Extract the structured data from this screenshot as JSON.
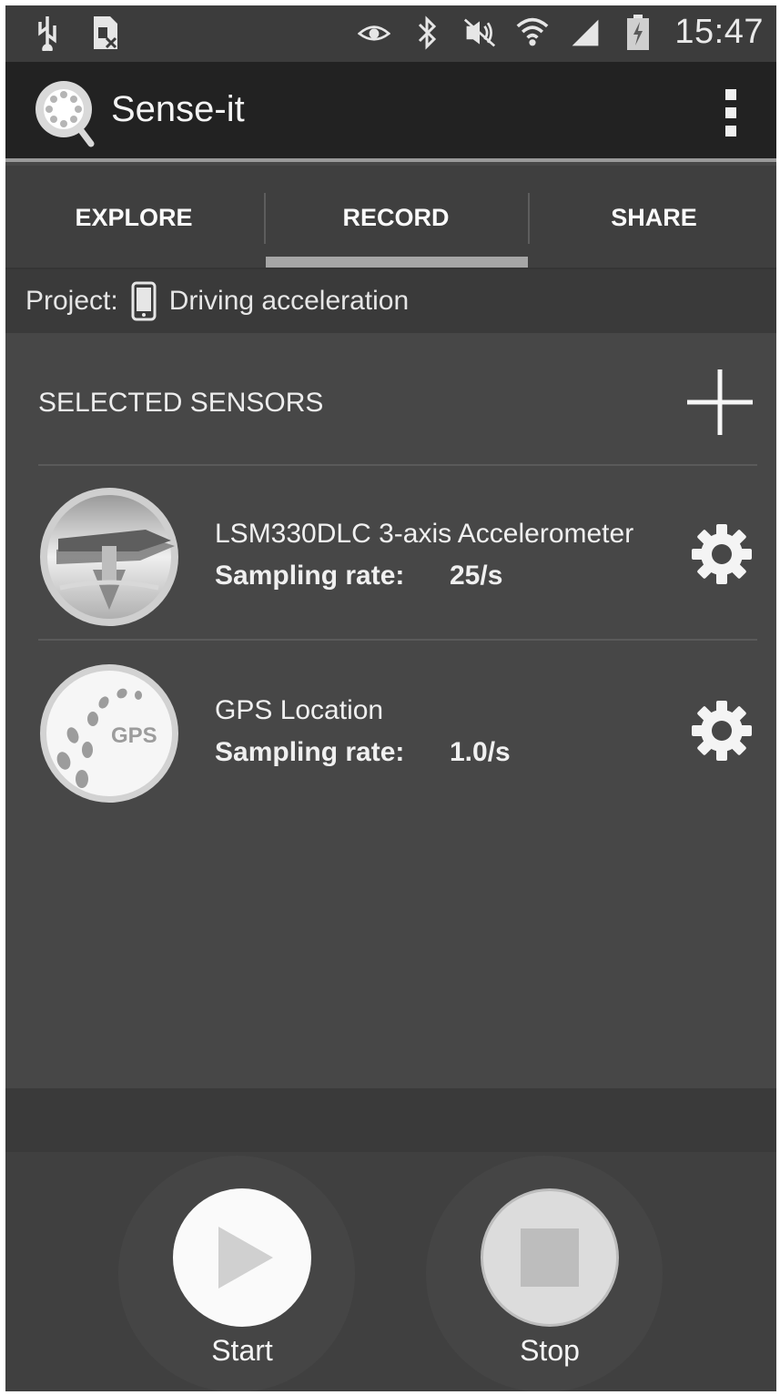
{
  "status_bar": {
    "time": "15:47",
    "icons_left": [
      "usb-icon",
      "no-sim-icon"
    ],
    "icons_right": [
      "eye-icon",
      "bluetooth-icon",
      "muted-icon",
      "wifi-icon",
      "signal-icon",
      "battery-icon"
    ]
  },
  "app": {
    "title": "Sense-it"
  },
  "tabs": [
    {
      "label": "EXPLORE",
      "selected": false
    },
    {
      "label": "RECORD",
      "selected": true
    },
    {
      "label": "SHARE",
      "selected": false
    }
  ],
  "project": {
    "prefix": "Project:",
    "name": "Driving acceleration"
  },
  "sensors_section": {
    "title": "SELECTED SENSORS",
    "items": [
      {
        "name": "LSM330DLC 3-axis Accelerometer",
        "rate_label": "Sampling rate:",
        "rate_value": "25/s",
        "icon": "accelerometer-icon"
      },
      {
        "name": "GPS Location",
        "rate_label": "Sampling rate:",
        "rate_value": "1.0/s",
        "icon": "gps-icon",
        "badge": "GPS"
      }
    ]
  },
  "controls": {
    "start_label": "Start",
    "stop_label": "Stop"
  },
  "colors": {
    "background": "#474747",
    "action_bar": "#222222",
    "tab_indicator": "#a6a6a6"
  }
}
